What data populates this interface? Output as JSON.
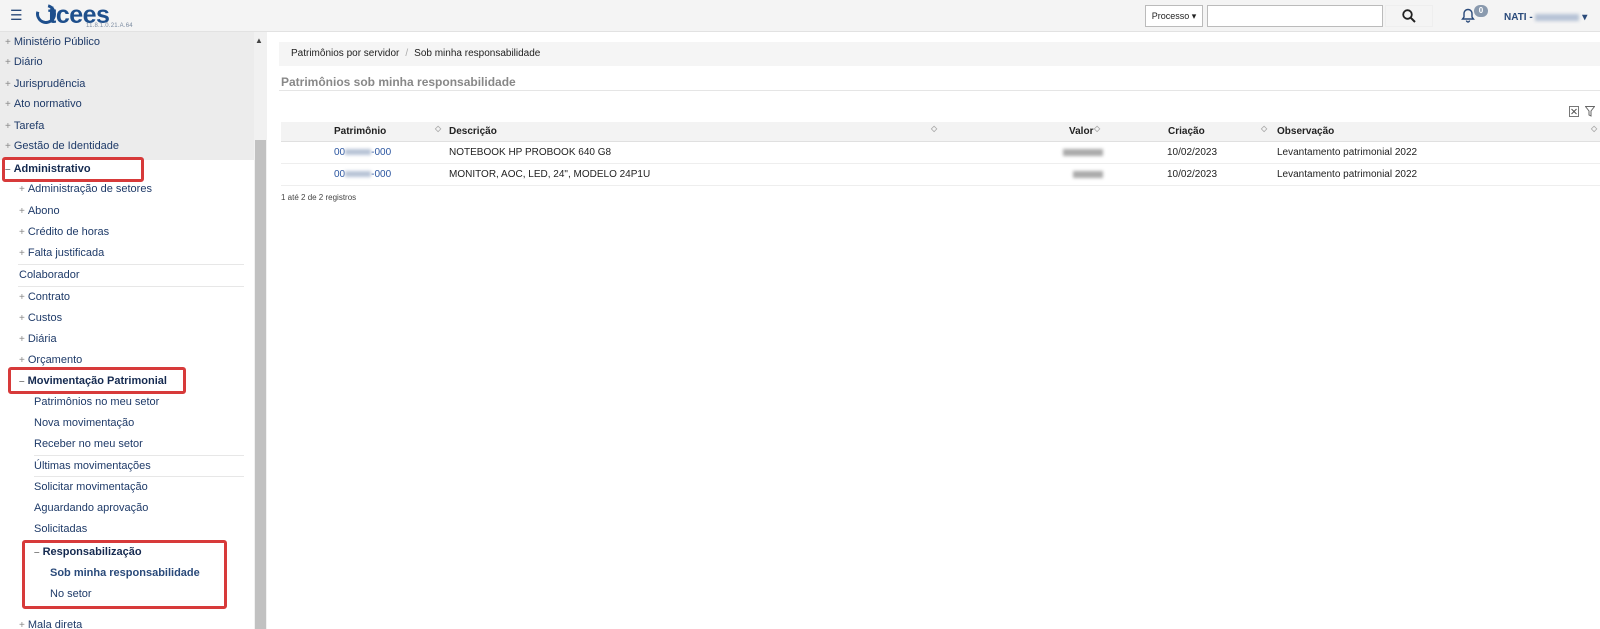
{
  "header": {
    "menu_icon": "hamburger-icon",
    "logo_text": "tcees",
    "version": "11.8.1.0.21.A.64",
    "process_button": "Processo ▾",
    "search_placeholder": "",
    "search_icon": "search-icon",
    "bell_icon": "bell-icon",
    "notification_count": "0",
    "user_name": "NATI - ",
    "user_caret": "▾"
  },
  "sidebar": {
    "top_items": [
      "Ministério Público",
      "Diário",
      "Jurisprudência",
      "Ato normativo",
      "Tarefa",
      "Gestão de Identidade"
    ],
    "administrativo": "Administrativo",
    "admin_items": [
      "Administração de setores",
      "Abono",
      "Crédito de horas",
      "Falta justificada"
    ],
    "colaborador": "Colaborador",
    "admin_items_2": [
      "Contrato",
      "Custos",
      "Diária",
      "Orçamento"
    ],
    "movimentacao": "Movimentação Patrimonial",
    "mov_items": [
      "Patrimônios no meu setor",
      "Nova movimentação",
      "Receber no meu setor",
      "Últimas movimentações",
      "Solicitar movimentação",
      "Aguardando aprovação",
      "Solicitadas"
    ],
    "responsabilizacao": "Responsabilização",
    "resp_items": [
      "Sob minha responsabilidade",
      "No setor"
    ],
    "last_item": "Mala direta"
  },
  "breadcrumb": [
    "Patrimônios por servidor",
    "Sob minha responsabilidade"
  ],
  "page_title": "Patrimônios sob minha responsabilidade",
  "table": {
    "columns": [
      "Patrimônio",
      "Descrição",
      "Valor",
      "Criação",
      "Observação"
    ],
    "rows": [
      {
        "patrimonio_prefix": "00",
        "patrimonio_suffix": "-000",
        "descricao": "NOTEBOOK HP PROBOOK 640 G8",
        "criacao": "10/02/2023",
        "observacao": "Levantamento patrimonial 2022"
      },
      {
        "patrimonio_prefix": "00",
        "patrimonio_suffix": "-000",
        "descricao": "MONITOR, AOC, LED, 24\", MODELO 24P1U",
        "criacao": "10/02/2023",
        "observacao": "Levantamento patrimonial 2022"
      }
    ],
    "footer": "1 até 2 de 2 registros"
  },
  "colors": {
    "brand": "#1e4f8c",
    "highlight": "#d73a3a",
    "link": "#2a55a0"
  }
}
